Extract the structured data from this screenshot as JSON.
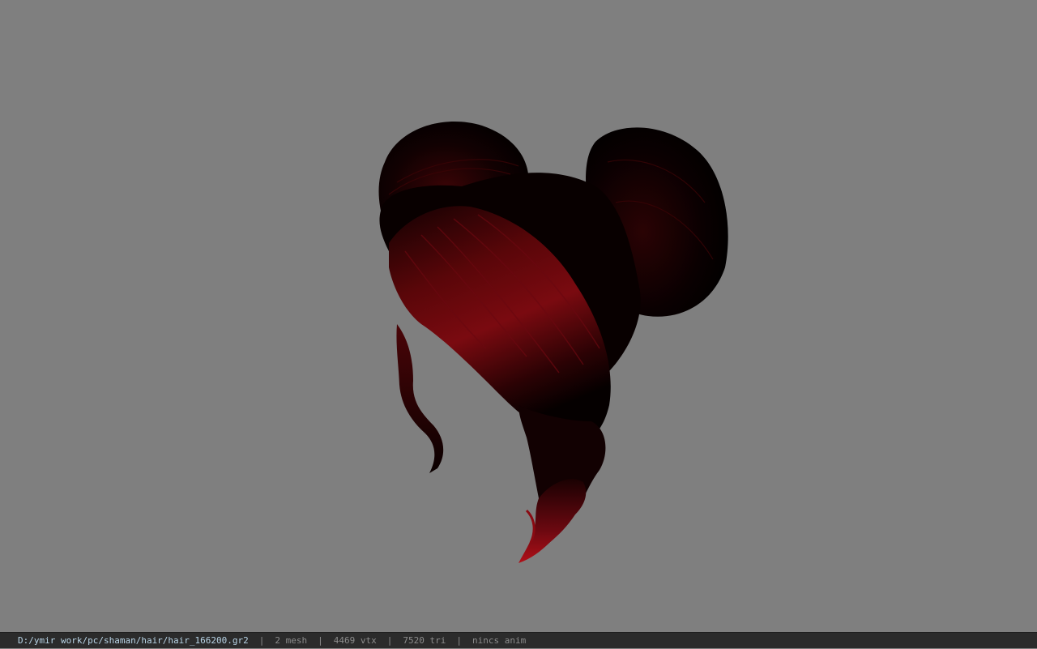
{
  "viewport": {
    "background_color": "#7f7f7f",
    "model": "hair mesh",
    "hair_colors": {
      "dark": "#050000",
      "mid": "#3a0406",
      "highlight": "#8c0c12"
    }
  },
  "statusbar": {
    "path": "D:/ymir work/pc/shaman/hair/hair_166200.gr2",
    "separator": "|",
    "mesh_count": "2 mesh",
    "vertex_count": "4469 vtx",
    "triangle_count": "7520 tri",
    "anim_status": "nincs anim"
  }
}
